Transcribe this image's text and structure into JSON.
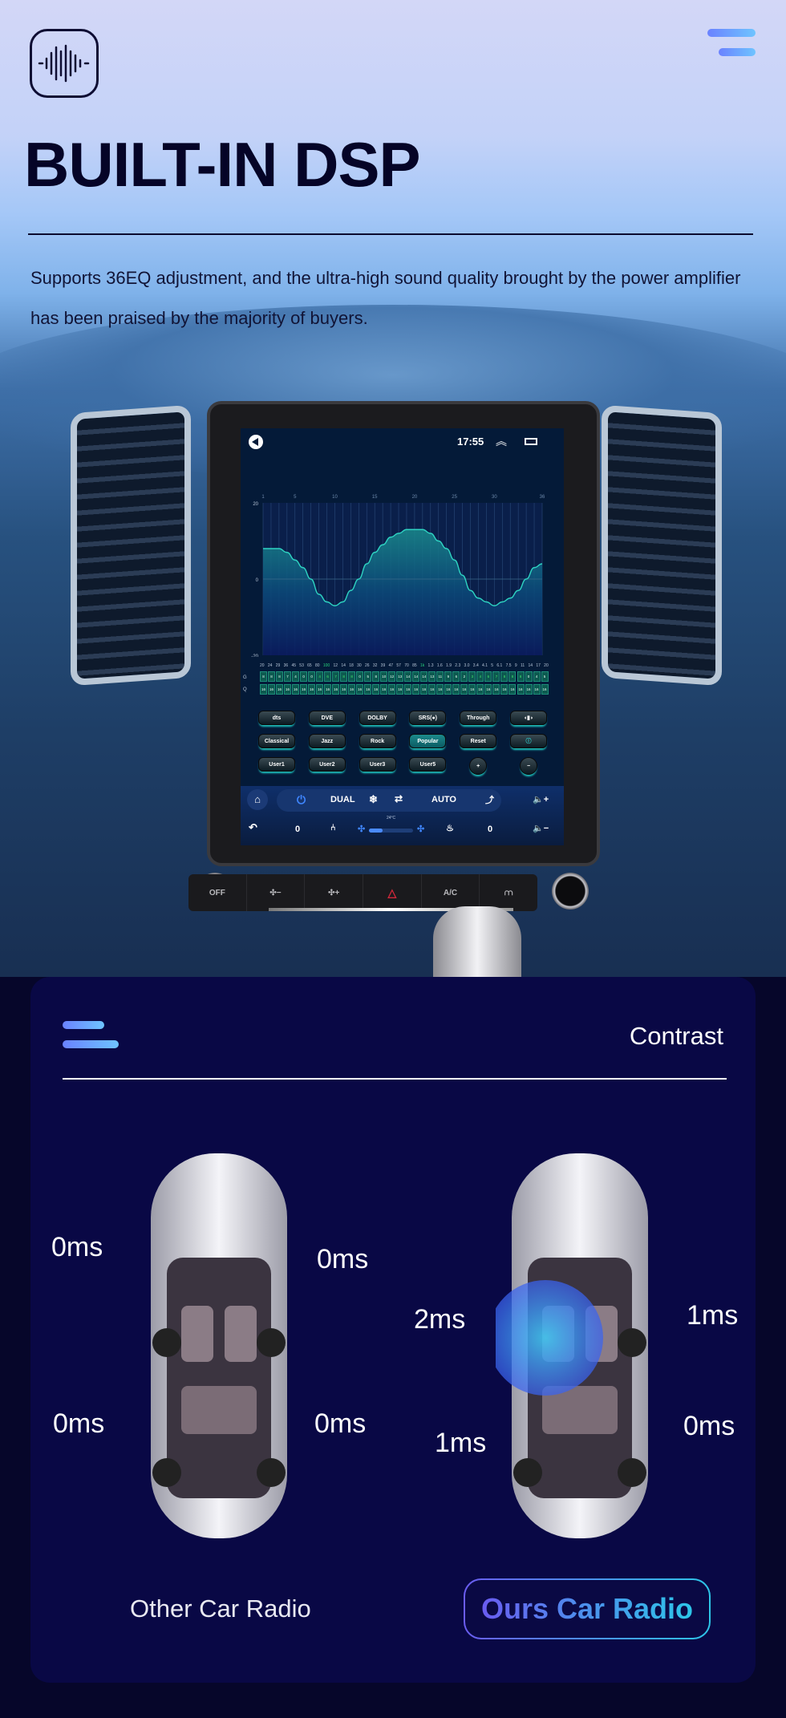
{
  "header": {
    "logo_icon": "sound-wave-icon",
    "menu_icon": "menu-icon",
    "title": "BUILT-IN DSP",
    "description": "Supports 36EQ adjustment, and the ultra-high sound quality brought by the power amplifier has been praised by the majority of buyers."
  },
  "head_unit": {
    "status_bar": {
      "time": "17:55",
      "back_icon": "back-icon",
      "collapse_icon": "double-chevron-up-icon",
      "recents_icon": "recent-apps-icon"
    },
    "equalizer": {
      "band_markers": [
        "1",
        "5",
        "10",
        "15",
        "20",
        "25",
        "30",
        "36"
      ],
      "y_labels": [
        "20",
        "0",
        "-20"
      ],
      "frequencies": [
        "20",
        "24",
        "29",
        "36",
        "45",
        "53",
        "65",
        "80",
        "100",
        "12",
        "14",
        "18",
        "30",
        "26",
        "32",
        "39",
        "47",
        "57",
        "70",
        "85",
        "1k",
        "1.3",
        "1.6",
        "1.9",
        "2.3",
        "3.0",
        "3.4",
        "4.1",
        "5",
        "6.1",
        "7.5",
        "9",
        "11",
        "14",
        "17",
        "20"
      ],
      "highlighted_frequencies": [
        "100",
        "1k"
      ],
      "g_label": "G",
      "q_label": "Q",
      "g_values": [
        "8",
        "8",
        "8",
        "7",
        "4",
        "0",
        "0",
        "-4",
        "-6",
        "-7",
        "-8",
        "-8",
        "0",
        "5",
        "8",
        "10",
        "12",
        "13",
        "14",
        "14",
        "14",
        "13",
        "11",
        "9",
        "6",
        "2",
        "-3",
        "-4",
        "-6",
        "-7",
        "-8",
        "-8",
        "-8",
        "0",
        "4",
        "5"
      ],
      "q_values": [
        "16",
        "16",
        "16",
        "16",
        "16",
        "16",
        "16",
        "16",
        "16",
        "16",
        "16",
        "16",
        "16",
        "16",
        "16",
        "16",
        "16",
        "16",
        "16",
        "16",
        "16",
        "16",
        "16",
        "16",
        "16",
        "16",
        "16",
        "16",
        "16",
        "16",
        "16",
        "16",
        "16",
        "16",
        "16",
        "16"
      ],
      "curve_gain_db": [
        8,
        8,
        8,
        7,
        5,
        3,
        0,
        -4,
        -6,
        -7,
        -6,
        -3,
        0,
        4,
        7,
        9,
        11,
        12,
        13,
        13,
        13,
        12,
        10,
        8,
        5,
        1,
        -3,
        -5,
        -6,
        -7,
        -6,
        -5,
        -3,
        0,
        3,
        4
      ]
    },
    "sound_modes": [
      "dts",
      "DVE",
      "DOLBY",
      "SRS(●)",
      "Through",
      "surround-icon"
    ],
    "presets": [
      "Classical",
      "Jazz",
      "Rock",
      "Popular",
      "Reset",
      "info-icon"
    ],
    "active_preset": "Popular",
    "user_presets": [
      "User1",
      "User2",
      "User3",
      "User5",
      "+",
      "−"
    ],
    "climate": {
      "dual": "DUAL",
      "auto": "AUTO",
      "temp": "24°C",
      "left_value": "0",
      "right_value": "0",
      "fan_level": 0.3
    },
    "physical_buttons": [
      "OFF",
      "fan-minus",
      "fan-plus",
      "hazard",
      "A/C",
      "defrost"
    ]
  },
  "contrast": {
    "title": "Contrast",
    "other": {
      "label": "Other Car Radio",
      "front_left": "0ms",
      "front_right": "0ms",
      "rear_left": "0ms",
      "rear_right": "0ms"
    },
    "ours": {
      "label": "Ours Car Radio",
      "front_left": "2ms",
      "front_right": "1ms",
      "rear_left": "1ms",
      "rear_right": "0ms"
    }
  }
}
